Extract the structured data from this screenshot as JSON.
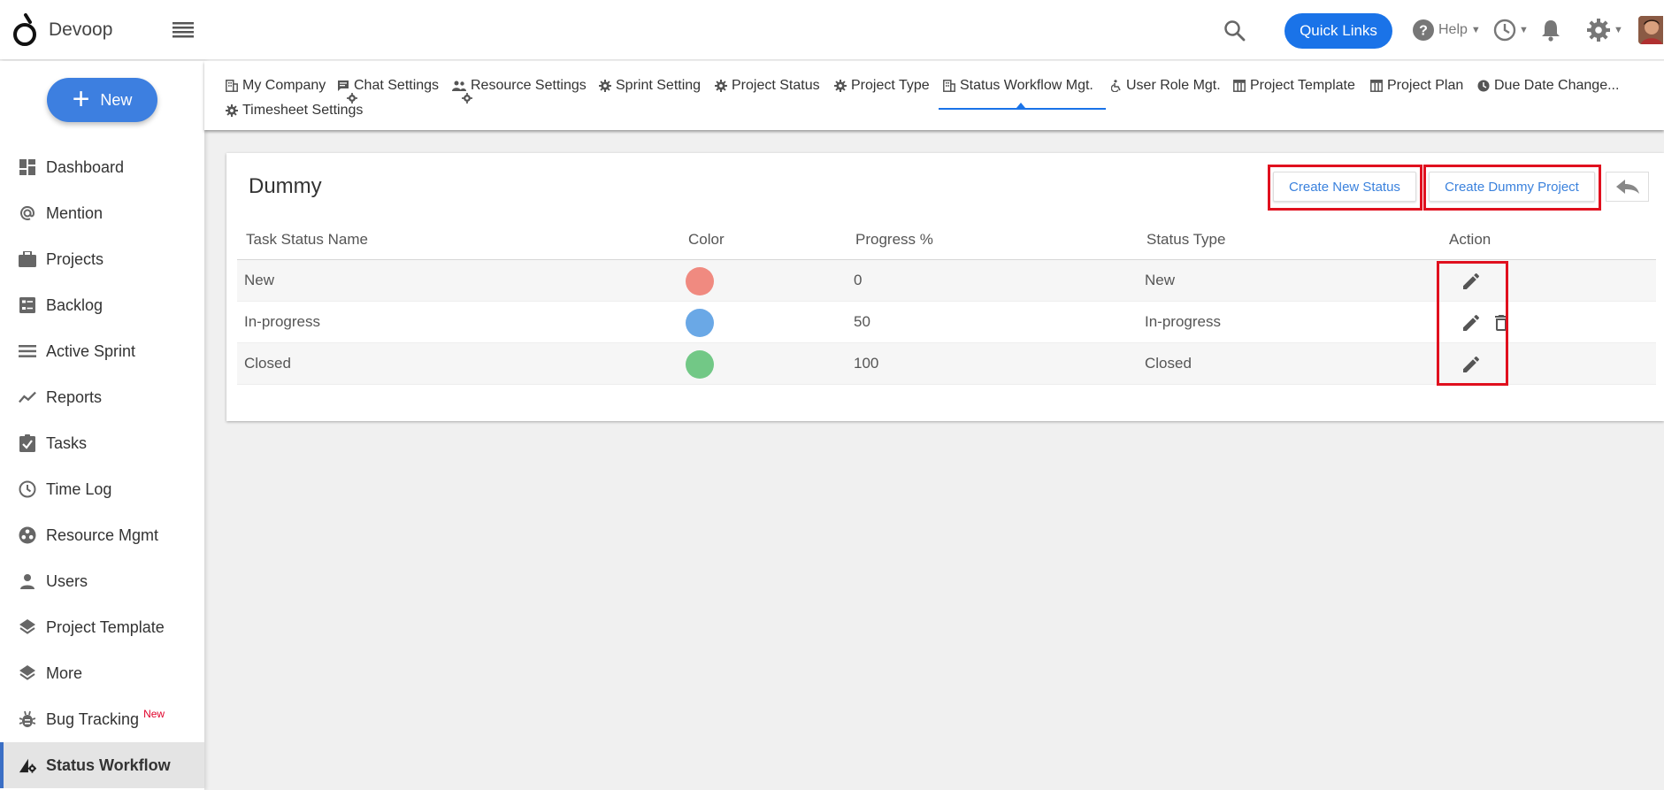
{
  "app": {
    "name": "Devoop"
  },
  "header": {
    "quick_links": "Quick Links",
    "help": "Help"
  },
  "sidebar": {
    "new_button": "New",
    "items": [
      {
        "label": "Dashboard",
        "icon": "dashboard-icon"
      },
      {
        "label": "Mention",
        "icon": "at-icon"
      },
      {
        "label": "Projects",
        "icon": "briefcase-icon"
      },
      {
        "label": "Backlog",
        "icon": "backlog-icon"
      },
      {
        "label": "Active Sprint",
        "icon": "sprint-icon"
      },
      {
        "label": "Reports",
        "icon": "reports-icon"
      },
      {
        "label": "Tasks",
        "icon": "tasks-icon"
      },
      {
        "label": "Time Log",
        "icon": "clock-icon"
      },
      {
        "label": "Resource Mgmt",
        "icon": "resource-icon"
      },
      {
        "label": "Users",
        "icon": "user-icon"
      },
      {
        "label": "Project Template",
        "icon": "layers-icon"
      },
      {
        "label": "More",
        "icon": "layers-icon"
      },
      {
        "label": "Bug Tracking",
        "icon": "bug-icon",
        "badge": "New"
      },
      {
        "label": "Status Workflow",
        "icon": "workflow-icon",
        "active": true
      }
    ]
  },
  "tabs": [
    {
      "label": "My Company",
      "icon": "building-icon"
    },
    {
      "label": "Chat Settings",
      "icon": "chat-icon"
    },
    {
      "label": "Resource Settings",
      "icon": "people-icon"
    },
    {
      "label": "Sprint Setting",
      "icon": "gear-icon"
    },
    {
      "label": "Project Status",
      "icon": "gear-icon"
    },
    {
      "label": "Project Type",
      "icon": "gear-icon"
    },
    {
      "label": "Status Workflow Mgt.",
      "icon": "building-icon",
      "active": true
    },
    {
      "label": "User Role Mgt.",
      "icon": "accessibility-icon"
    },
    {
      "label": "Project Template",
      "icon": "template-icon"
    },
    {
      "label": "Project Plan",
      "icon": "template-icon"
    },
    {
      "label": "Due Date Change...",
      "icon": "clock-icon"
    },
    {
      "label": "Timesheet Settings",
      "icon": "gear-icon"
    }
  ],
  "card": {
    "title": "Dummy",
    "create_status": "Create New Status",
    "create_dummy": "Create Dummy Project",
    "columns": [
      "Task Status Name",
      "Color",
      "Progress %",
      "Status Type",
      "Action"
    ],
    "rows": [
      {
        "name": "New",
        "color": "#f08a80",
        "progress": "0",
        "type": "New",
        "actions": [
          "edit"
        ]
      },
      {
        "name": "In-progress",
        "color": "#6aa8e6",
        "progress": "50",
        "type": "In-progress",
        "actions": [
          "edit",
          "delete"
        ]
      },
      {
        "name": "Closed",
        "color": "#72c886",
        "progress": "100",
        "type": "Closed",
        "actions": [
          "edit"
        ]
      }
    ]
  },
  "colors": {
    "accent": "#1a73e8",
    "highlight": "#e0101e"
  }
}
